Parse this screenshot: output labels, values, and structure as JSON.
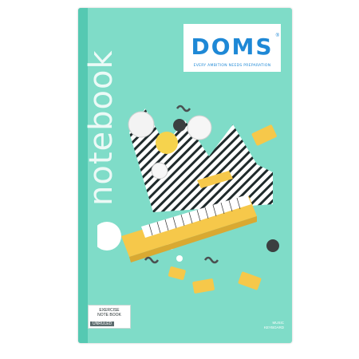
{
  "product": {
    "brand": "DOMS",
    "tagline": "EVERY AMBITION NEEDS PREPARATION",
    "vertical_title": "notebook",
    "label_title_line1": "EXERCISE",
    "label_title_line2": "NOTE BOOK",
    "label_sub": "UNRULED",
    "bottom_right_line1": "MUSIC",
    "bottom_right_line2": "KEYBOARD"
  },
  "colors": {
    "cover": "#7fdcc8",
    "spine": "#55c9b2",
    "brand_blue": "#1e88d6",
    "keyboard_yellow": "#f6c84a"
  }
}
